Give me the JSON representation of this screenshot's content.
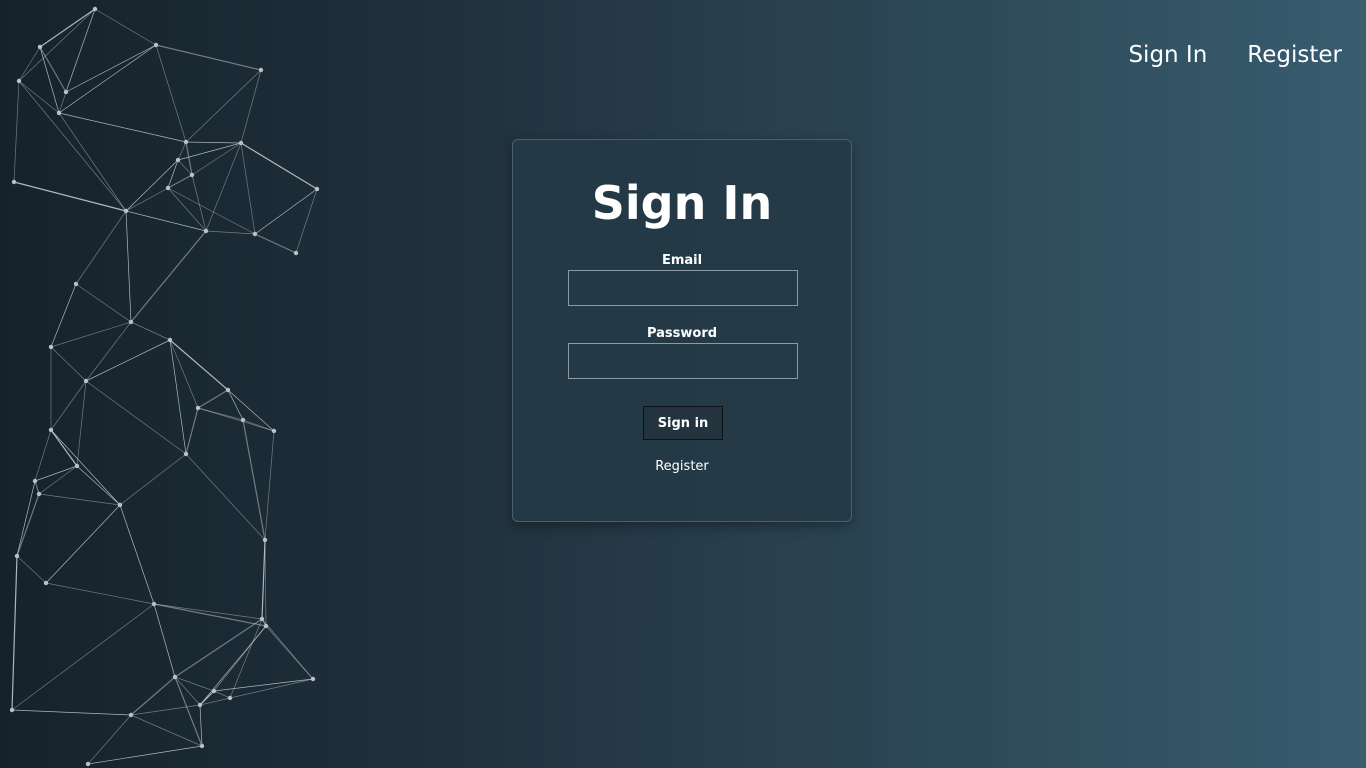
{
  "nav": {
    "signin_label": "Sign In",
    "register_label": "Register"
  },
  "form": {
    "title": "Sign In",
    "email_label": "Email",
    "email_value": "",
    "password_label": "Password",
    "password_value": "",
    "submit_label": "Sign in",
    "register_link": "Register"
  },
  "colors": {
    "bg_left": "#16222b",
    "bg_right": "#375d6f",
    "card_bg": "#243946",
    "text": "#ffffff"
  }
}
